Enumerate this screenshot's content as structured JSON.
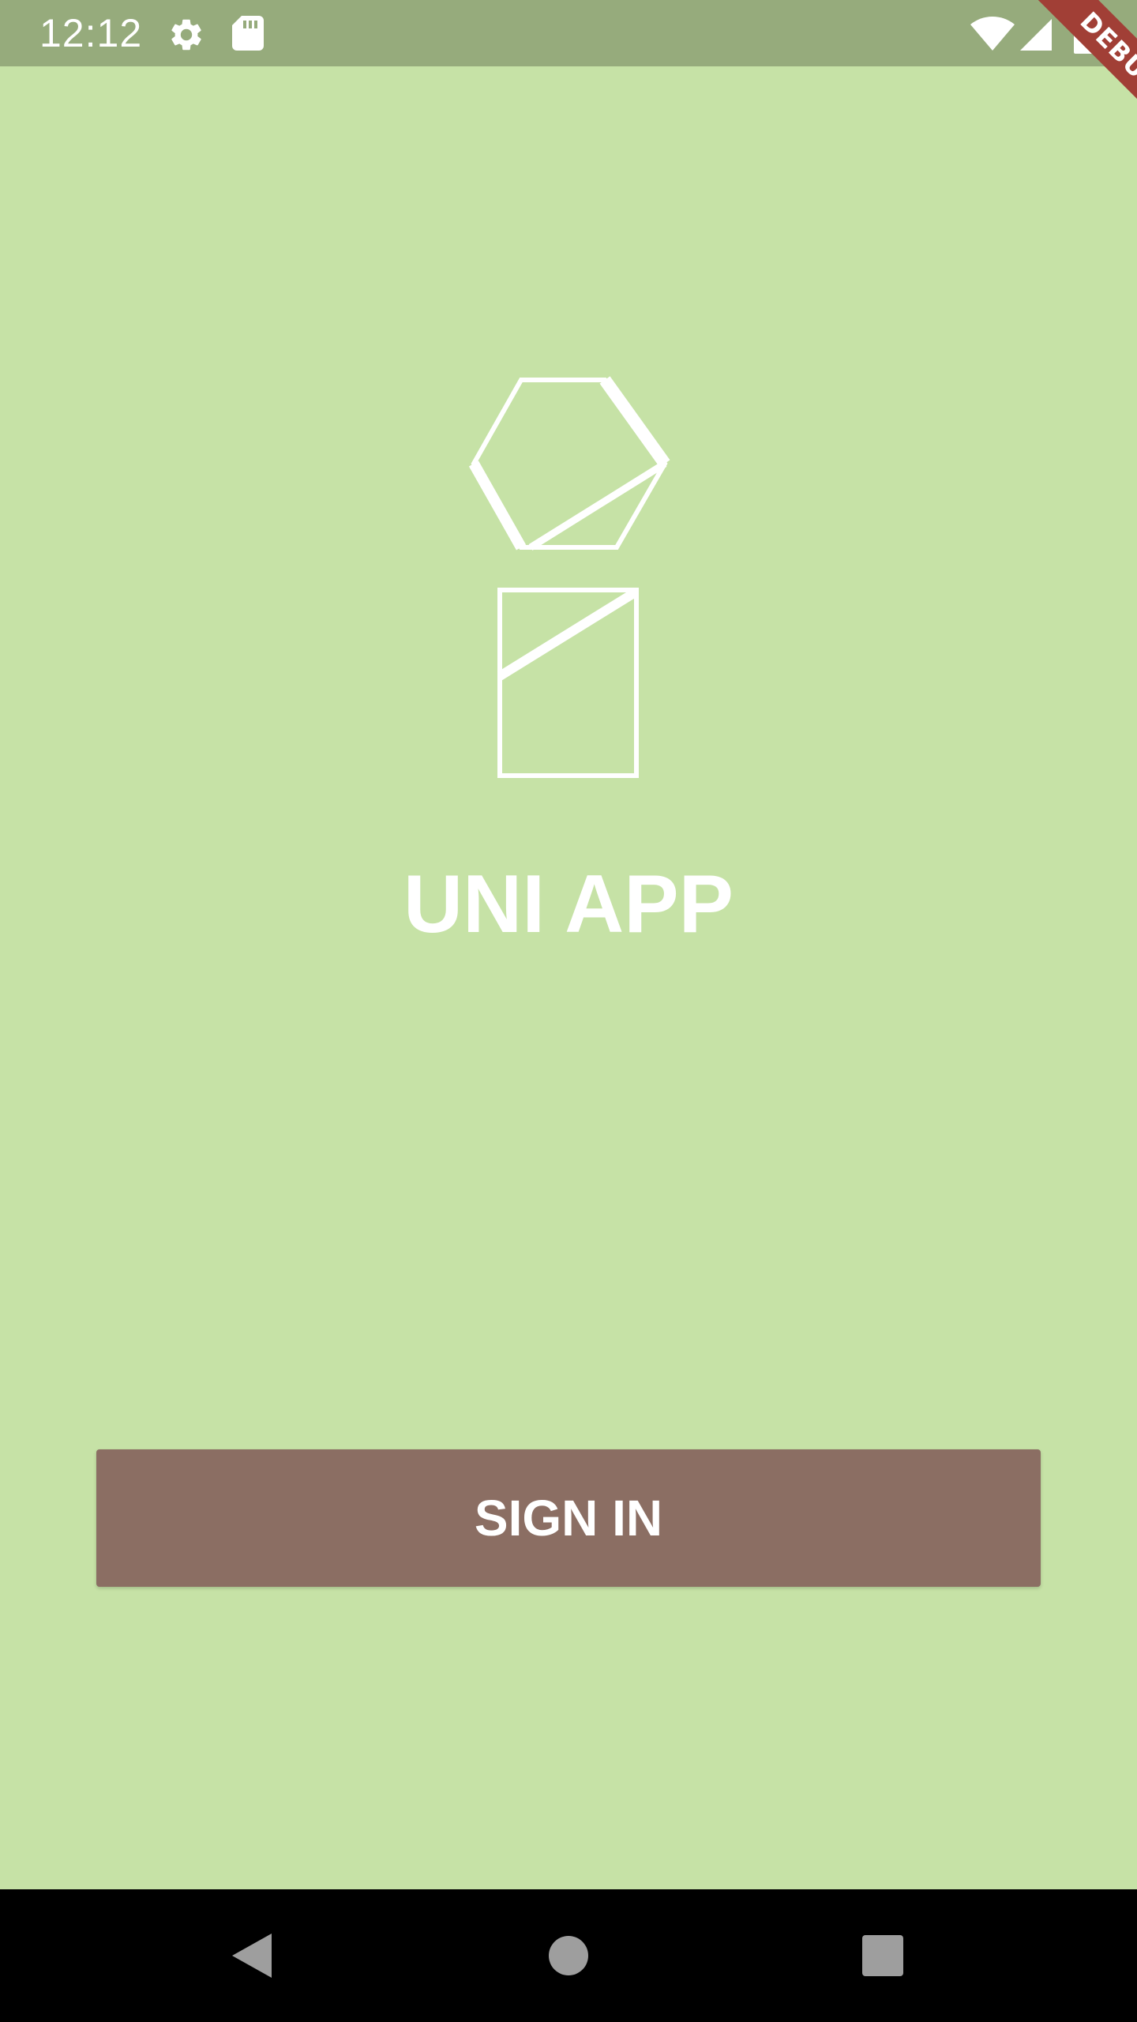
{
  "status_bar": {
    "time": "12:12",
    "icons": [
      "settings-icon",
      "sd-card-icon",
      "wifi-icon",
      "cellular-signal-icon",
      "battery-charging-icon"
    ]
  },
  "debug_banner": {
    "label": "DEBUG",
    "color": "#a13f36"
  },
  "app": {
    "logo_icon": "uni-app-logo-icon",
    "title": "UNI APP"
  },
  "actions": {
    "sign_in_label": "SIGN IN"
  },
  "navigation_bar": {
    "buttons": [
      "back-icon",
      "home-icon",
      "recents-icon"
    ]
  },
  "colors": {
    "background": "#c6e2a6",
    "status_bar": "#96ab7c",
    "button": "#8b6e63",
    "text": "#ffffff",
    "nav_bar": "#000000"
  }
}
